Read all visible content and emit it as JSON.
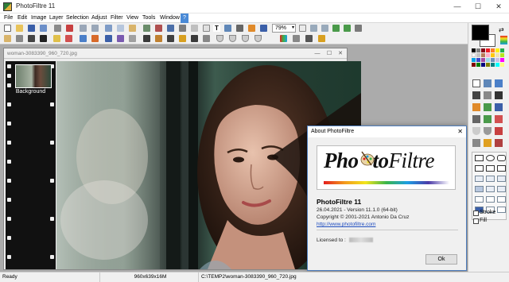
{
  "window": {
    "title": "PhotoFiltre 11",
    "minimize": "—",
    "maximize": "☐",
    "close": "✕"
  },
  "menu": [
    "File",
    "Edit",
    "Image",
    "Layer",
    "Selection",
    "Adjust",
    "Filter",
    "View",
    "Tools",
    "Window",
    "?"
  ],
  "toolbar": {
    "zoom": "79%"
  },
  "document": {
    "title": "woman-3083390_960_720.jpg",
    "layer_label": "Background"
  },
  "about": {
    "title": "About PhotoFiltre",
    "logo_part1": "Pho",
    "logo_part2": "to",
    "logo_part3": "Filtre",
    "product": "PhotoFiltre 11",
    "version": "26.04.2021 - Version 11.1.0 (64-bit)",
    "copyright": "Copyright © 2001-2021  Antonio Da Cruz",
    "website": "http://www.photofiltre.com",
    "licensed_to": "Licensed to :",
    "ok": "Ok"
  },
  "panel": {
    "stroke": "Stroke",
    "fill": "Fill"
  },
  "status": {
    "state": "Ready",
    "dimensions": "960x639x16M",
    "path": "C:\\TEMP2\\woman-3083390_960_720.jpg"
  },
  "colors": {
    "foreground": "#000000",
    "background": "#ffffff",
    "accent": "#4a8ad6"
  }
}
